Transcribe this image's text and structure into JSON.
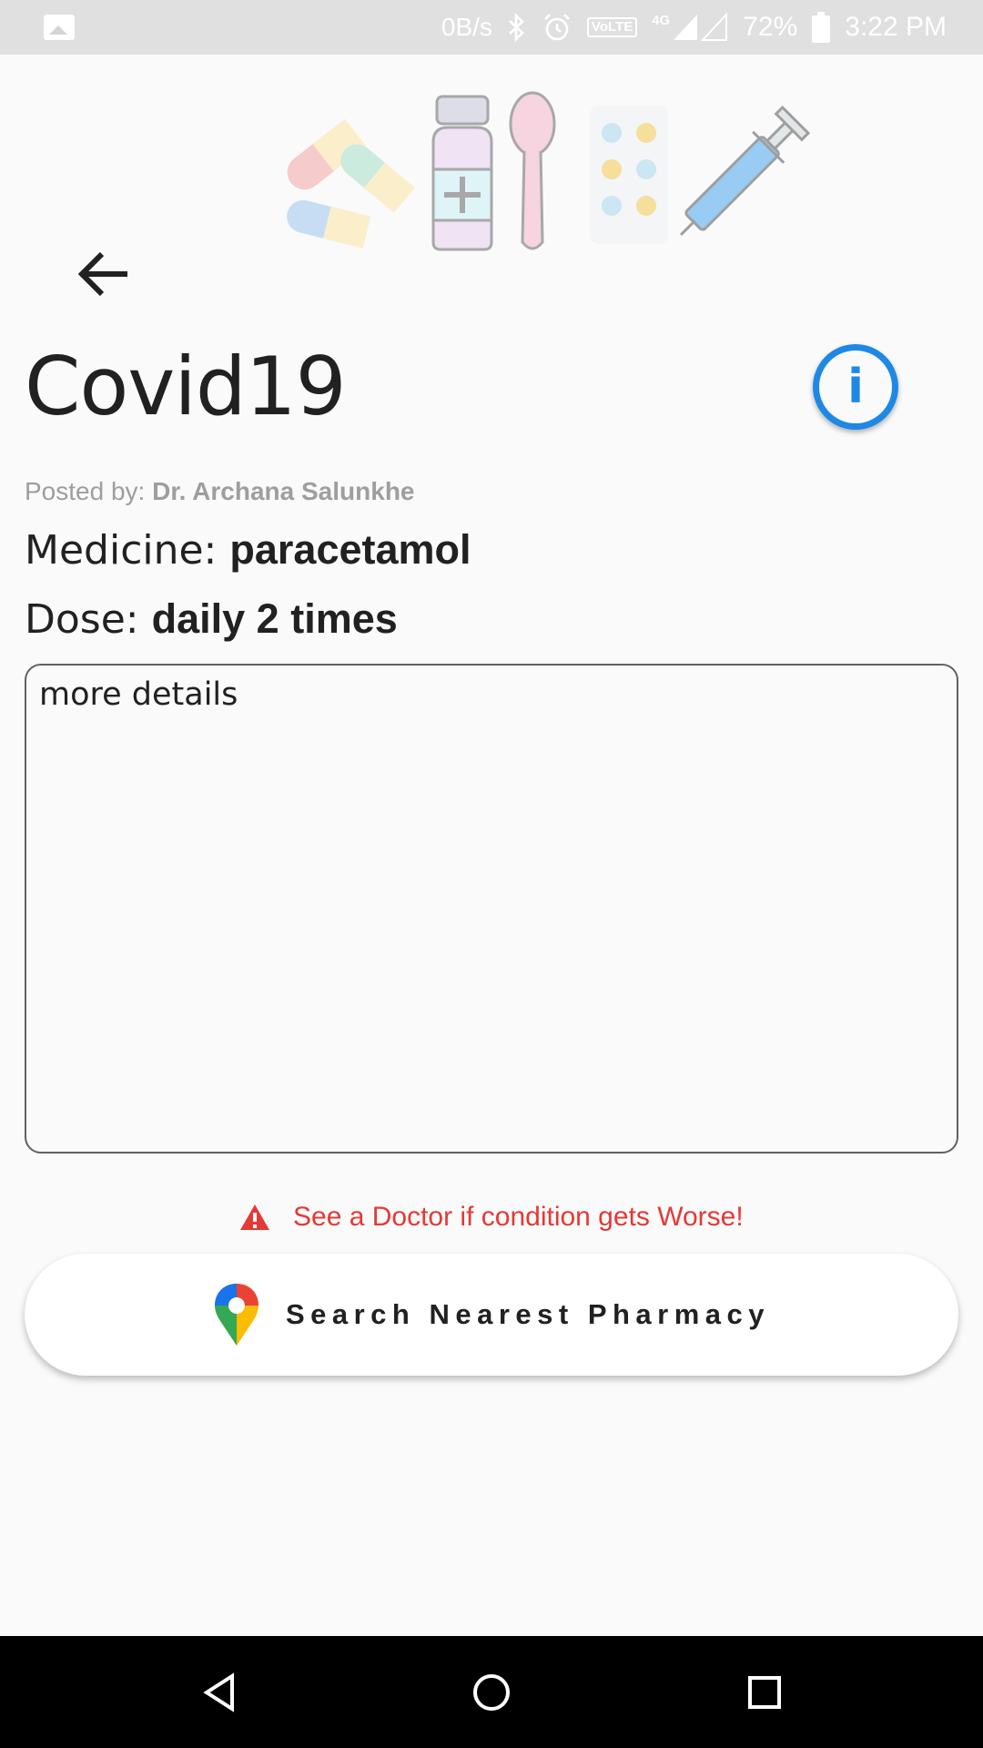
{
  "status_bar": {
    "speed": "0B/s",
    "network": "VoLTE",
    "network_type": "4G",
    "battery": "72%",
    "time": "3:22 PM",
    "icons": [
      "gallery-icon",
      "bluetooth-icon",
      "alarm-icon",
      "signal-icon",
      "battery-icon"
    ]
  },
  "banner": {
    "icons": [
      "capsules-icon",
      "syrup-bottle-icon",
      "spoon-icon",
      "pill-blister-icon",
      "syringe-icon"
    ]
  },
  "header": {
    "back_icon": "arrow-back-icon",
    "title": "Covid19",
    "info_icon": "info-icon"
  },
  "post": {
    "posted_by_label": "Posted by:",
    "posted_by_name": "Dr. Archana Salunkhe",
    "medicine_label": "Medicine:",
    "medicine_value": "paracetamol",
    "dose_label": "Dose:",
    "dose_value": "daily 2 times",
    "details": "more details"
  },
  "warning": {
    "icon": "warning-icon",
    "text": "See a Doctor if condition gets Worse!",
    "color": "#e53935"
  },
  "pharmacy_button": {
    "icon": "google-maps-pin-icon",
    "label": "Search Nearest Pharmacy"
  },
  "colors": {
    "accent": "#1e88e5",
    "warning": "#e53935",
    "background": "#fafafa"
  },
  "nav_bar": {
    "icons": [
      "nav-back-icon",
      "nav-home-icon",
      "nav-recents-icon"
    ]
  }
}
